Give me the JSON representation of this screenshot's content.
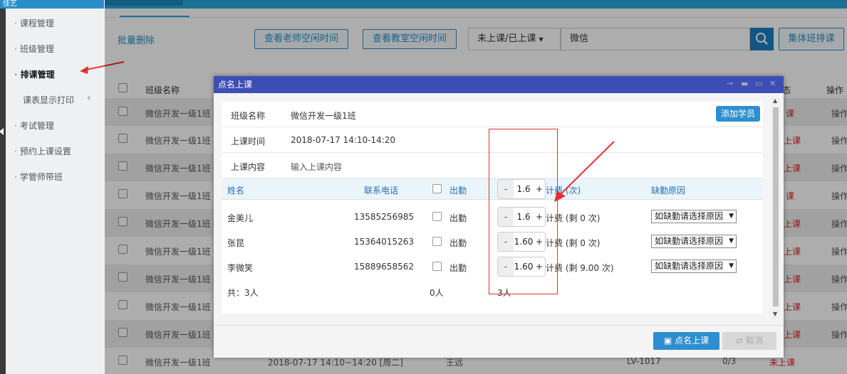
{
  "app": {
    "brand": "佳艺"
  },
  "sidebar": {
    "items": [
      {
        "label": "课程管理"
      },
      {
        "label": "班级管理"
      },
      {
        "label": "排课管理"
      },
      {
        "label": "课表显示打印"
      },
      {
        "label": "考试管理"
      },
      {
        "label": "预约上课设置"
      },
      {
        "label": "学管师带班"
      }
    ],
    "expand_glyph": "‹"
  },
  "toolbar": {
    "batch_delete": "批量删除",
    "teacher_free": "查看老师空闲时间",
    "room_free": "查看教室空闲时间",
    "status_select": "未上课/已上课",
    "search_value": "微信",
    "group_schedule": "集体班排课"
  },
  "table": {
    "headers": {
      "name": "班级名称",
      "op_partial": "操作",
      "status_partial": "态"
    },
    "rows": [
      {
        "name": "微信开发一级1班",
        "status": "课",
        "op": "操作"
      },
      {
        "name": "微信开发一级1班",
        "status": "上课",
        "op": "操作"
      },
      {
        "name": "微信开发一级1班",
        "status": "上课",
        "op": "操作"
      },
      {
        "name": "微信开发一级1班",
        "status": "课",
        "op": "操作"
      },
      {
        "name": "微信开发一级1班",
        "status": "上课",
        "op": "操作"
      },
      {
        "name": "微信开发一级1班",
        "status": "上课",
        "op": "操作"
      },
      {
        "name": "微信开发一级1班",
        "status": "上课",
        "op": "操作"
      },
      {
        "name": "微信开发一级1班",
        "status": "上课",
        "op": "操作"
      },
      {
        "name": "微信开发一级1班",
        "status": "上课",
        "op": "操作"
      }
    ],
    "last_row": {
      "name": "微信开发一级1班",
      "time": "2018-07-17 14:10~14:20 [周二]",
      "teacher": "王远",
      "room": "LV-1017",
      "count": "0/3",
      "status": "未上课"
    }
  },
  "modal": {
    "title": "点名上课",
    "class_label": "班级名称",
    "class_value": "微信开发一级1班",
    "add_student": "添加学员",
    "time_label": "上课时间",
    "time_value": "2018-07-17 14:10-14:20",
    "content_label": "上课内容",
    "content_placeholder": "输入上课内容",
    "columns": {
      "name": "姓名",
      "phone": "联系电话",
      "attend": "出勤",
      "count": "计费 (次)",
      "reason": "缺勤原因"
    },
    "header_stepper": {
      "minus": "-",
      "value": "1.6",
      "plus": "+"
    },
    "students": [
      {
        "name": "金美儿",
        "phone": "13585256985",
        "attend": "出勤",
        "value": "1.6",
        "billing": "计费 (剩 0 次)",
        "reason": "如缺勤请选择原因"
      },
      {
        "name": "张昆",
        "phone": "15364015263",
        "attend": "出勤",
        "value": "1.60",
        "billing": "计费 (剩 0 次)",
        "reason": "如缺勤请选择原因"
      },
      {
        "name": "李微笑",
        "phone": "15889658562",
        "attend": "出勤",
        "value": "1.60",
        "billing": "计费 (剩 9.00 次)",
        "reason": "如缺勤请选择原因"
      }
    ],
    "summary": {
      "total": "共：3人",
      "attended": "0人",
      "billed": "3人"
    },
    "roll_call_button": "点名上课",
    "cancel_button": "取消"
  }
}
